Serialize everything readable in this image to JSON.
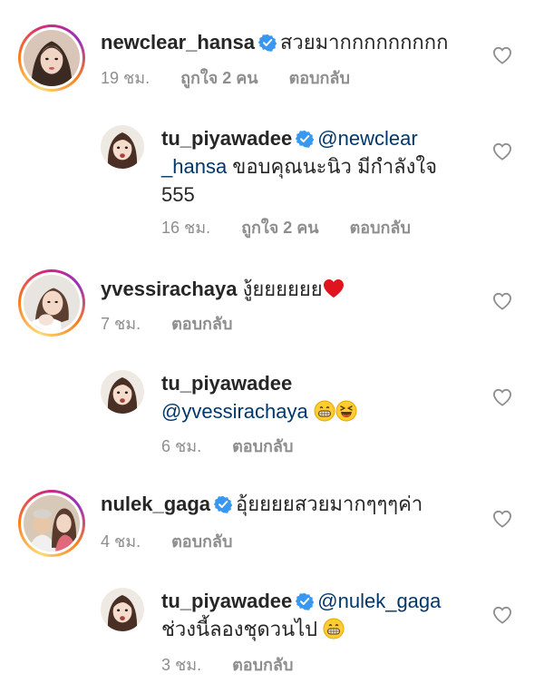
{
  "colors": {
    "text": "#262626",
    "meta": "#8e8e8e",
    "mention": "#00376b",
    "verified": "#3897f0",
    "heart_emoji": "#e0141e"
  },
  "comments": [
    {
      "username": "newclear_hansa",
      "verified": true,
      "text": "สวยมากกกกกกกกก",
      "time": "19 ชม.",
      "likes": "ถูกใจ 2 คน",
      "reply_label": "ตอบกลับ",
      "avatar_icon": "avatar-photo",
      "like_icon": "heart-outline-icon"
    },
    {
      "username": "tu_piyawadee",
      "verified": true,
      "mention": "@newclear",
      "text_line2_mention": "_hansa",
      "text_line2": " ขอบคุณนะนิว มีกำลังใจ",
      "text_line3": "555",
      "time": "16 ชม.",
      "likes": "ถูกใจ 2 คน",
      "reply_label": "ตอบกลับ"
    },
    {
      "username": "yvessirachaya",
      "verified": false,
      "text": "งู้ยยยยยย",
      "emoji": "red-heart-emoji",
      "time": "7 ชม.",
      "reply_label": "ตอบกลับ"
    },
    {
      "username": "tu_piyawadee",
      "verified": false,
      "mention": "@yvessirachaya",
      "emoji": [
        "grinning-emoji",
        "laughing-emoji"
      ],
      "time": "6 ชม.",
      "reply_label": "ตอบกลับ"
    },
    {
      "username": "nulek_gaga",
      "verified": true,
      "text": "อุ้ยยยยสวยมากๆๆๆค่า",
      "time": "4 ชม.",
      "reply_label": "ตอบกลับ"
    },
    {
      "username": "tu_piyawadee",
      "verified": true,
      "mention": "@nulek_gaga",
      "text_line2": "ช่วงนี้ลองชุดวนไป",
      "emoji": "grinning-emoji",
      "time": "3 ชม.",
      "reply_label": "ตอบกลับ"
    }
  ]
}
